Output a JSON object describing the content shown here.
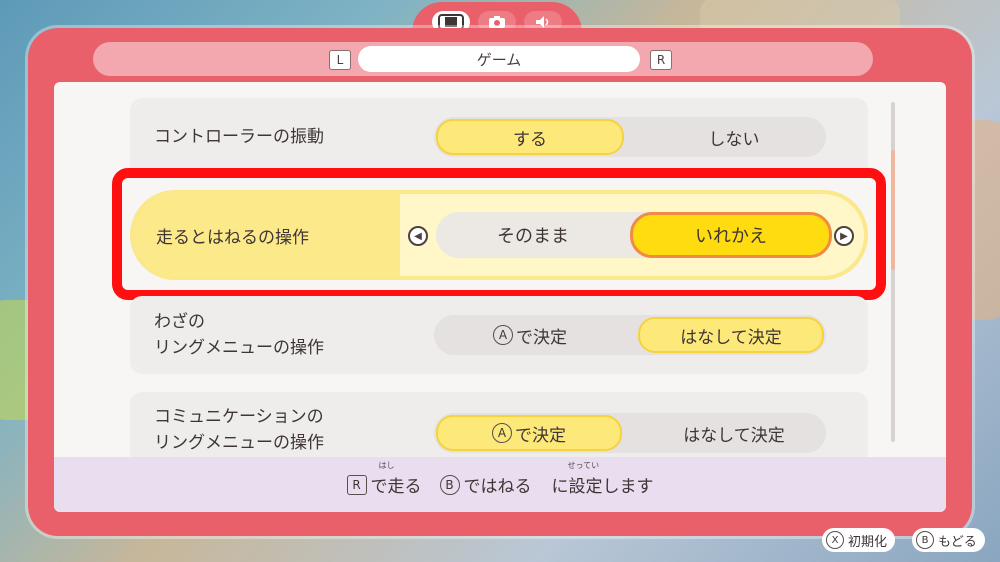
{
  "header": {
    "l_button": "L",
    "r_button": "R",
    "tab_title": "ゲーム",
    "icons": [
      "game-console-icon",
      "camera-icon",
      "speaker-icon"
    ]
  },
  "settings": [
    {
      "label": "コントローラーの振動",
      "options": [
        "する",
        "しない"
      ],
      "selected": 0
    },
    {
      "label": "走るとはねるの操作",
      "options": [
        "そのまま",
        "いれかえ"
      ],
      "selected": 1
    },
    {
      "label_line1": "わざの",
      "label_line2": "リングメニューの操作",
      "options": [
        "で決定",
        "はなして決定"
      ],
      "option_button": "A",
      "selected": 1
    },
    {
      "label_line1": "コミュニケーションの",
      "label_line2": "リングメニューの操作",
      "options": [
        "で決定",
        "はなして決定"
      ],
      "option_button": "A",
      "selected": 0
    }
  ],
  "hint": {
    "r_key": "R",
    "text1": "で走る",
    "ruby1": "はし",
    "b_key": "B",
    "text2": "ではねる",
    "text3": "に設定します",
    "ruby3": "せってい"
  },
  "footer": {
    "reset_key": "X",
    "reset_label": "初期化",
    "back_key": "B",
    "back_label": "もどる"
  },
  "colors": {
    "frame": "#e9606a",
    "selected_option": "#fde97a",
    "active_option": "#fedc10",
    "highlight_border": "#ff0f0f"
  }
}
